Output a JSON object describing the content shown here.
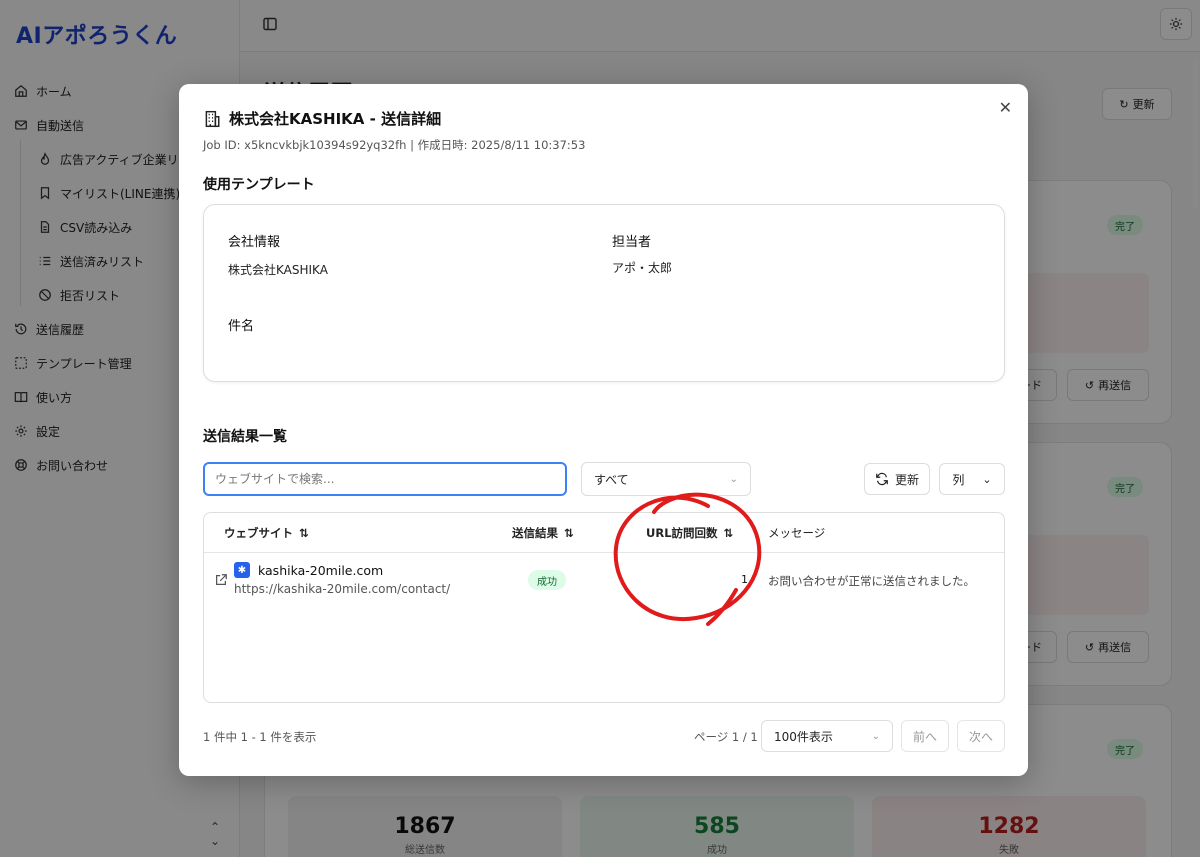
{
  "app": {
    "logo": "AIアポろうくん"
  },
  "sidebar": {
    "items": [
      {
        "label": "ホーム",
        "icon": "home-icon"
      },
      {
        "label": "自動送信",
        "icon": "mail-icon"
      },
      {
        "label": "広告アクティブ企業リスト",
        "icon": "flame-icon",
        "sub": true
      },
      {
        "label": "マイリスト(LINE連携)",
        "icon": "bookmark-icon",
        "sub": true
      },
      {
        "label": "CSV読み込み",
        "icon": "file-icon",
        "sub": true
      },
      {
        "label": "送信済みリスト",
        "icon": "list-icon",
        "sub": true
      },
      {
        "label": "拒否リスト",
        "icon": "ban-icon",
        "sub": true
      },
      {
        "label": "送信履歴",
        "icon": "history-icon"
      },
      {
        "label": "テンプレート管理",
        "icon": "template-icon"
      },
      {
        "label": "使い方",
        "icon": "book-icon"
      },
      {
        "label": "設定",
        "icon": "gear-icon"
      },
      {
        "label": "お問い合わせ",
        "icon": "support-icon"
      }
    ]
  },
  "background": {
    "page_title": "送信履歴",
    "refresh_label": "更新",
    "badge_done": "完了",
    "download_label": "ード",
    "resend_label": "再送信",
    "stats": [
      {
        "value": "1867",
        "label": "総送信数",
        "color": "#111111",
        "bg": "#f3f3f3"
      },
      {
        "value": "585",
        "label": "成功",
        "color": "#15803d",
        "bg": "#ecf8ef"
      },
      {
        "value": "1282",
        "label": "失敗",
        "color": "#b91c1c",
        "bg": "#fbefef"
      }
    ]
  },
  "modal": {
    "title": "株式会社KASHIKA - 送信詳細",
    "subtitle": "Job ID: x5kncvkbjk10394s92yq32fh | 作成日時: 2025/8/11 10:37:53",
    "template_section": "使用テンプレート",
    "company_label": "会社情報",
    "company_value": "株式会社KASHIKA",
    "person_label": "担当者",
    "person_value": "アポ・太郎",
    "subject_label": "件名",
    "results_section": "送信結果一覧",
    "search_placeholder": "ウェブサイトで検索...",
    "filter_value": "すべて",
    "refresh_label": "更新",
    "columns_label": "列",
    "table": {
      "headers": [
        "ウェブサイト",
        "送信結果",
        "URL訪問回数",
        "メッセージ"
      ],
      "rows": [
        {
          "site": "kashika-20mile.com",
          "url": "https://kashika-20mile.com/contact/",
          "result": "成功",
          "visits": "1",
          "message": "お問い合わせが正常に送信されました。"
        }
      ]
    },
    "footer": {
      "count_text": "1 件中 1 - 1 件を表示",
      "page_text": "ページ 1 / 1",
      "per_page": "100件表示",
      "prev": "前へ",
      "next": "次へ"
    }
  }
}
